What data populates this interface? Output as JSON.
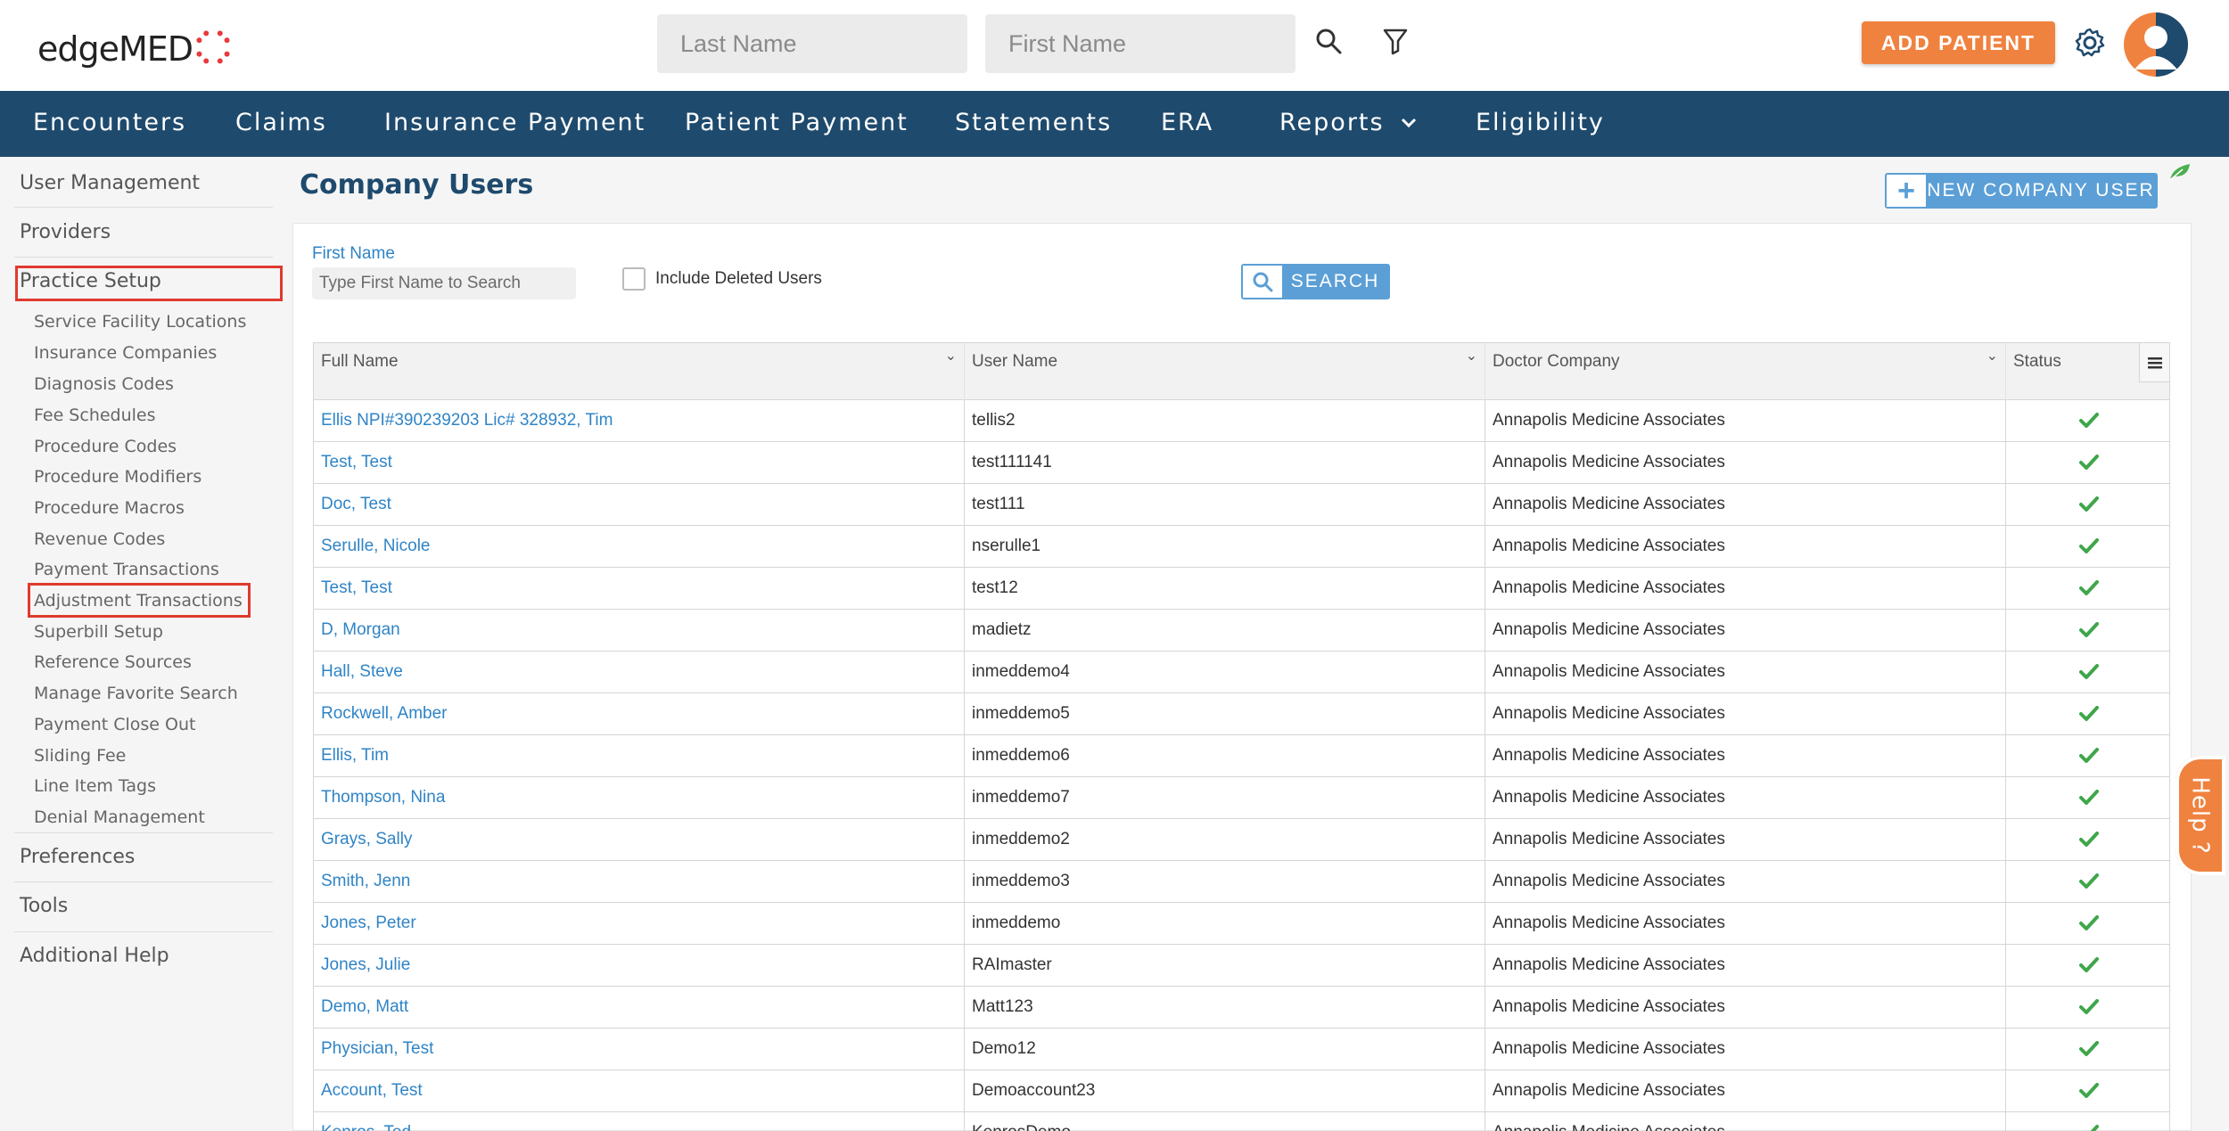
{
  "header": {
    "logo_text": "edgeMED",
    "last_name_placeholder": "Last Name",
    "first_name_placeholder": "First Name",
    "add_patient_label": "ADD PATIENT",
    "icons": [
      "search-icon",
      "filter-icon",
      "gear-icon",
      "avatar"
    ]
  },
  "nav": {
    "items": [
      "Encounters",
      "Claims",
      "Insurance Payment",
      "Patient Payment",
      "Statements",
      "ERA",
      "Reports",
      "Eligibility"
    ]
  },
  "sidebar": {
    "user_management": "User Management",
    "providers": "Providers",
    "practice_setup": "Practice Setup",
    "sub_items": [
      "Service Facility Locations",
      "Insurance Companies",
      "Diagnosis Codes",
      "Fee Schedules",
      "Procedure Codes",
      "Procedure Modifiers",
      "Procedure Macros",
      "Revenue Codes",
      "Payment Transactions",
      "Adjustment Transactions",
      "Superbill Setup",
      "Reference Sources",
      "Manage Favorite Search",
      "Payment Close Out",
      "Sliding Fee",
      "Line Item Tags",
      "Denial Management"
    ],
    "preferences": "Preferences",
    "tools": "Tools",
    "additional_help": "Additional Help"
  },
  "main": {
    "title": "Company Users",
    "new_user_label": "NEW COMPANY USER",
    "first_name_label": "First Name",
    "first_name_placeholder": "Type First Name to Search",
    "include_deleted_label": "Include Deleted Users",
    "include_deleted_checked": false,
    "search_label": "SEARCH"
  },
  "table": {
    "columns": [
      "Full Name",
      "User Name",
      "Doctor Company",
      "Status"
    ],
    "rows": [
      {
        "name": "Ellis NPI#390239203 Lic# 328932, Tim",
        "user": "tellis2",
        "company": "Annapolis Medicine Associates",
        "status": "active"
      },
      {
        "name": "Test, Test",
        "user": "test111141",
        "company": "Annapolis Medicine Associates",
        "status": "active"
      },
      {
        "name": "Doc, Test",
        "user": "test111",
        "company": "Annapolis Medicine Associates",
        "status": "active"
      },
      {
        "name": "Serulle, Nicole",
        "user": "nserulle1",
        "company": "Annapolis Medicine Associates",
        "status": "active"
      },
      {
        "name": "Test, Test",
        "user": "test12",
        "company": "Annapolis Medicine Associates",
        "status": "active"
      },
      {
        "name": "D, Morgan",
        "user": "madietz",
        "company": "Annapolis Medicine Associates",
        "status": "active"
      },
      {
        "name": "Hall, Steve",
        "user": "inmeddemo4",
        "company": "Annapolis Medicine Associates",
        "status": "active"
      },
      {
        "name": "Rockwell, Amber",
        "user": "inmeddemo5",
        "company": "Annapolis Medicine Associates",
        "status": "active"
      },
      {
        "name": "Ellis, Tim",
        "user": "inmeddemo6",
        "company": "Annapolis Medicine Associates",
        "status": "active"
      },
      {
        "name": "Thompson, Nina",
        "user": "inmeddemo7",
        "company": "Annapolis Medicine Associates",
        "status": "active"
      },
      {
        "name": "Grays, Sally",
        "user": "inmeddemo2",
        "company": "Annapolis Medicine Associates",
        "status": "active"
      },
      {
        "name": "Smith, Jenn",
        "user": "inmeddemo3",
        "company": "Annapolis Medicine Associates",
        "status": "active"
      },
      {
        "name": "Jones, Peter",
        "user": "inmeddemo",
        "company": "Annapolis Medicine Associates",
        "status": "active"
      },
      {
        "name": "Jones, Julie",
        "user": "RAImaster",
        "company": "Annapolis Medicine Associates",
        "status": "active"
      },
      {
        "name": "Demo, Matt",
        "user": "Matt123",
        "company": "Annapolis Medicine Associates",
        "status": "active"
      },
      {
        "name": "Physician, Test",
        "user": "Demo12",
        "company": "Annapolis Medicine Associates",
        "status": "active"
      },
      {
        "name": "Account, Test",
        "user": "Demoaccount23",
        "company": "Annapolis Medicine Associates",
        "status": "active"
      },
      {
        "name": "Kenros, Ted",
        "user": "KenrosDemo",
        "company": "Annapolis Medicine Associates",
        "status": "active"
      }
    ]
  },
  "help_label": "Help ?",
  "colors": {
    "nav_bg": "#1e4a6d",
    "accent_orange": "#f0823f",
    "link_blue": "#2f84c6",
    "button_blue": "#5b9fd6",
    "check_green": "#3fa64a",
    "highlight_red": "#e03a2e"
  }
}
